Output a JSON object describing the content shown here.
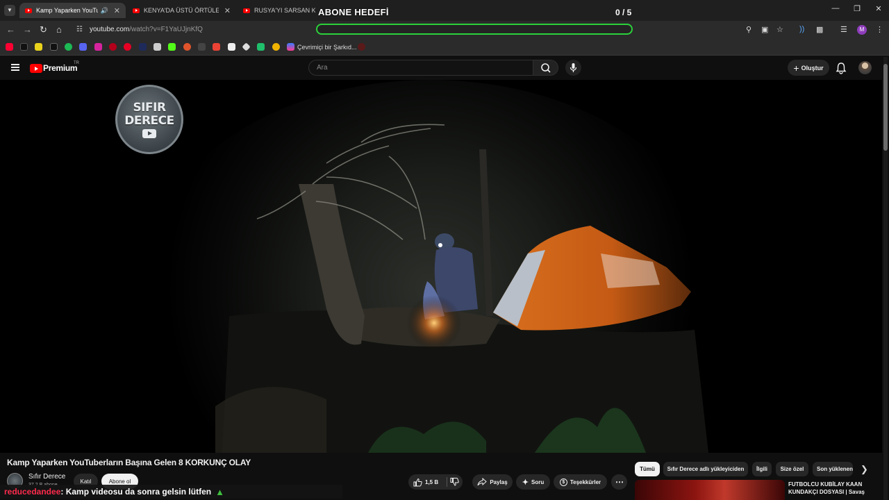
{
  "browser": {
    "tabs": [
      {
        "label": "Kamp Yaparken YouTuberla",
        "active": true
      },
      {
        "label": "KENYA'DA ÜSTÜ ÖRTÜLEN KO",
        "active": false
      },
      {
        "label": "RUSYA'YI SARSAN KARANLIK",
        "active": false
      }
    ],
    "url_host": "youtube.com",
    "url_path": "/watch?v=F1YaUJjnKfQ",
    "bookmark_label": "Çevrimiçi bir Şarkıd...",
    "profile_letter": "M",
    "window_controls": [
      "minimize",
      "restore",
      "close"
    ]
  },
  "overlay": {
    "title": "ABONE HEDEFİ",
    "count": "0 / 5",
    "bar_color": "#2bd13a",
    "progress": 0
  },
  "youtube": {
    "brand": "Premium",
    "country": "TR",
    "search_placeholder": "Ara",
    "create_label": "Oluştur"
  },
  "video": {
    "watermark_line1": "SIFIR",
    "watermark_line2": "DERECE",
    "title": "Kamp Yaparken YouTuberların Başına Gelen 8 KORKUNÇ OLAY",
    "channel": "Sıfır Derece",
    "subscribers": "37,2 B abone",
    "join_label": "Katıl",
    "subscribe_label": "Abone ol",
    "likes": "1,5 B",
    "share_label": "Paylaş",
    "ask_label": "Soru",
    "thanks_label": "Teşekkürler"
  },
  "chat": {
    "user": "reducedandee",
    "message": ": Kamp videosu da sonra gelsin lütfen"
  },
  "sidebar": {
    "chips": [
      "Tümü",
      "Sıfır Derece adlı yükleyiciden",
      "İlgili",
      "Size özel",
      "Son yüklenenler"
    ],
    "selected_chip": "Tümü",
    "recommended_title": "FUTBOLCU KUBİLAY KAAN KUNDAKÇI DOSYASI | Savaş"
  },
  "colors": {
    "background": "#0f0f0f",
    "youtube_red": "#ff0000",
    "chat_user": "#ff2b4d"
  }
}
